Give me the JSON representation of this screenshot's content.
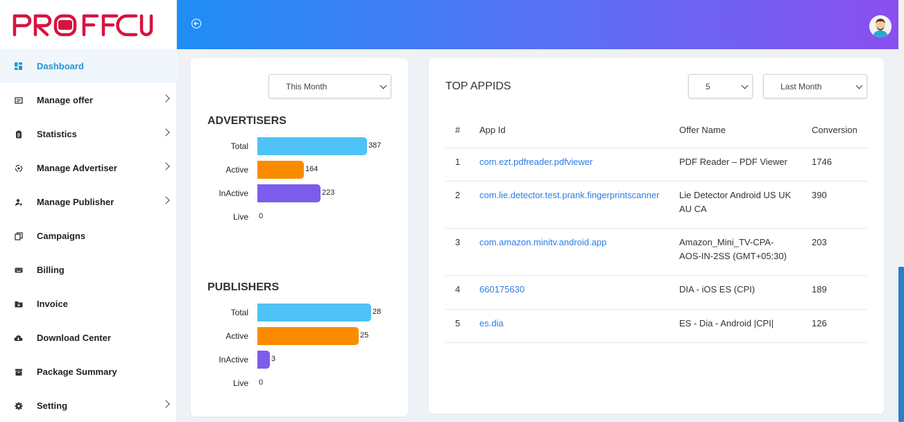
{
  "brand": {
    "name": "PROFFCUS",
    "color": "#d5153f"
  },
  "sidebar": {
    "items": [
      {
        "label": "Dashboard",
        "icon": "dashboard-icon",
        "active": true,
        "chevron": false
      },
      {
        "label": "Manage offer",
        "icon": "offer-icon",
        "active": false,
        "chevron": true
      },
      {
        "label": "Statistics",
        "icon": "clipboard-icon",
        "active": false,
        "chevron": true
      },
      {
        "label": "Manage Advertiser",
        "icon": "advertiser-icon",
        "active": false,
        "chevron": true
      },
      {
        "label": "Manage Publisher",
        "icon": "publisher-icon",
        "active": false,
        "chevron": true
      },
      {
        "label": "Campaigns",
        "icon": "campaigns-icon",
        "active": false,
        "chevron": false
      },
      {
        "label": "Billing",
        "icon": "keyboard-icon",
        "active": false,
        "chevron": false
      },
      {
        "label": "Invoice",
        "icon": "folder-icon",
        "active": false,
        "chevron": false
      },
      {
        "label": "Download Center",
        "icon": "cloud-download-icon",
        "active": false,
        "chevron": false
      },
      {
        "label": "Package Summary",
        "icon": "package-icon",
        "active": false,
        "chevron": false
      },
      {
        "label": "Setting",
        "icon": "gear-icon",
        "active": false,
        "chevron": true
      }
    ]
  },
  "header": {
    "collapse_icon": "arrow-left-circle-icon",
    "avatar_icon": "user-avatar-icon"
  },
  "left_panel": {
    "period_select": "This Month",
    "advertisers": {
      "title": "ADVERTISERS",
      "rows": [
        {
          "label": "Total",
          "value": "387",
          "color": "#4fc3f7"
        },
        {
          "label": "Active",
          "value": "164",
          "color": "#fb8c00"
        },
        {
          "label": "InActive",
          "value": "223",
          "color": "#7b5cec"
        },
        {
          "label": "Live",
          "value": "0",
          "color": "#4fc3f7"
        }
      ]
    },
    "publishers": {
      "title": "PUBLISHERS",
      "rows": [
        {
          "label": "Total",
          "value": "28",
          "color": "#4fc3f7"
        },
        {
          "label": "Active",
          "value": "25",
          "color": "#fb8c00"
        },
        {
          "label": "InActive",
          "value": "3",
          "color": "#7b5cec"
        },
        {
          "label": "Live",
          "value": "0",
          "color": "#4fc3f7"
        }
      ]
    }
  },
  "right_panel": {
    "title": "TOP APPIDS",
    "count_select": "5",
    "period_select": "Last Month",
    "columns": [
      "#",
      "App Id",
      "Offer Name",
      "Conversion"
    ],
    "rows": [
      {
        "num": "1",
        "app_id": "com.ezt.pdfreader.pdfviewer",
        "offer_line1": "PDF Reader – PDF Viewer",
        "offer_line2": "",
        "conversion": "1746"
      },
      {
        "num": "2",
        "app_id": "com.lie.detector.test.prank.fingerprintscanner",
        "offer_line1": "Lie Detector Android US UK",
        "offer_line2": "AU CA",
        "conversion": "390"
      },
      {
        "num": "3",
        "app_id": "com.amazon.minitv.android.app",
        "offer_line1": "Amazon_Mini_TV-CPA-",
        "offer_line2": "AOS-IN-2SS (GMT+05:30)",
        "conversion": "203"
      },
      {
        "num": "4",
        "app_id": "660175630",
        "offer_line1": "DIA - iOS ES (CPI)",
        "offer_line2": "",
        "conversion": "189"
      },
      {
        "num": "5",
        "app_id": "es.dia",
        "offer_line1": "ES - Dia - Android |CPI|",
        "offer_line2": "",
        "conversion": "126"
      }
    ]
  }
}
